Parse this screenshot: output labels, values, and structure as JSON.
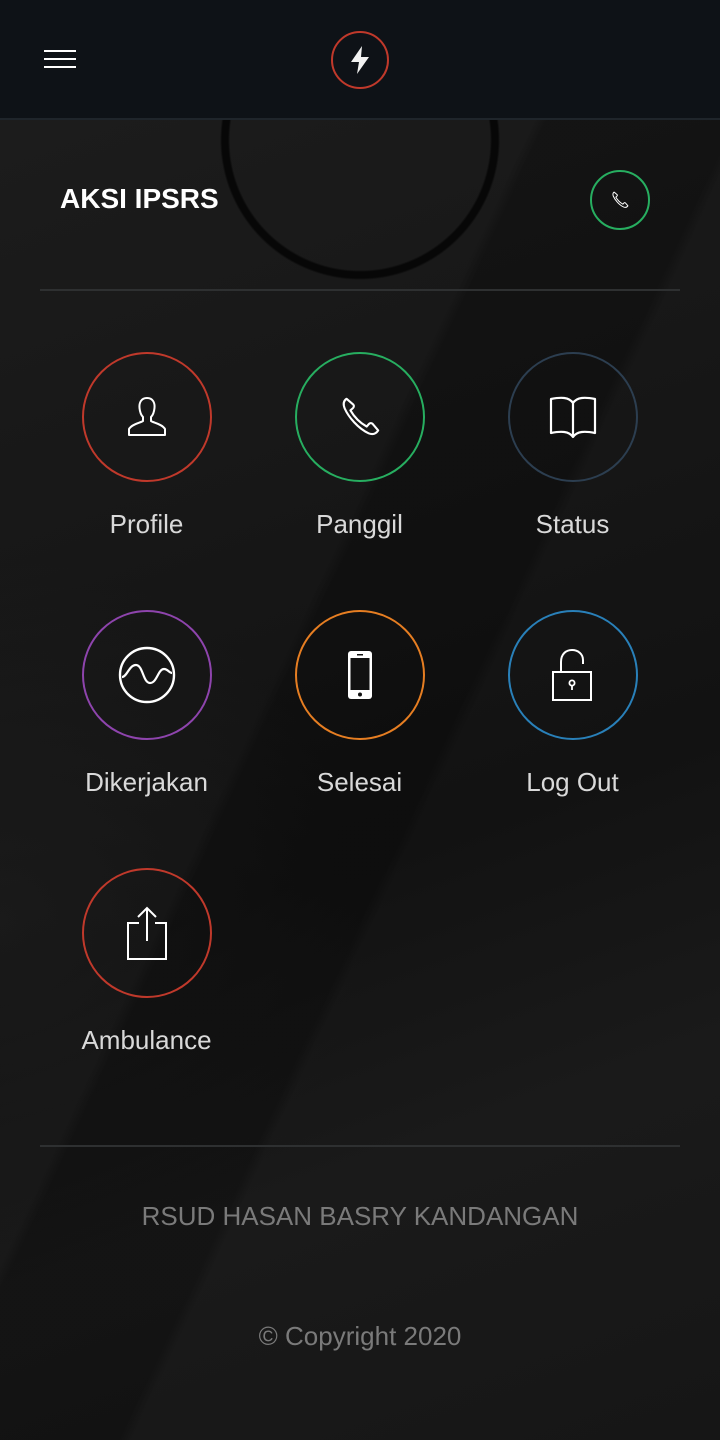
{
  "header": {
    "menu_icon": "hamburger-menu-icon",
    "logo_icon": "lightning-bolt-icon",
    "logo_color": "#c0392b"
  },
  "title_section": {
    "title": "AKSI IPSRS",
    "call_icon": "phone-icon",
    "call_color": "#27ae60"
  },
  "menu": [
    {
      "label": "Profile",
      "icon": "user-icon",
      "color": "#c0392b"
    },
    {
      "label": "Panggil",
      "icon": "phone-icon",
      "color": "#27ae60"
    },
    {
      "label": "Status",
      "icon": "book-icon",
      "color": "#2c3e50"
    },
    {
      "label": "Dikerjakan",
      "icon": "wave-icon",
      "color": "#8e44ad"
    },
    {
      "label": "Selesai",
      "icon": "smartphone-icon",
      "color": "#e67e22"
    },
    {
      "label": "Log Out",
      "icon": "unlock-icon",
      "color": "#2980b9"
    },
    {
      "label": "Ambulance",
      "icon": "share-icon",
      "color": "#c0392b"
    }
  ],
  "footer": {
    "organization": "RSUD HASAN BASRY KANDANGAN",
    "copyright": "© Copyright 2020"
  }
}
